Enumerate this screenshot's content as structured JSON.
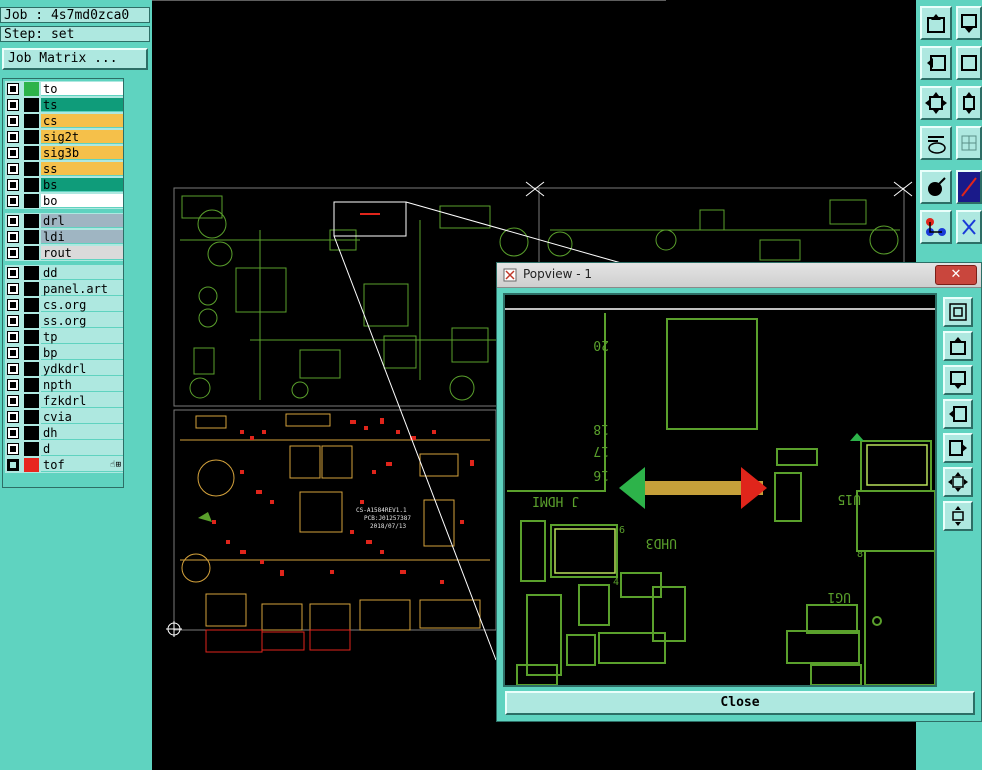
{
  "header": {
    "job_label": "Job : 4s7md0zca0",
    "step_label": "Step: set",
    "job_matrix_button": "Job Matrix ..."
  },
  "layers": {
    "group1": [
      {
        "name": "to",
        "swatch": "#2db34a",
        "bg": "#ffffff"
      },
      {
        "name": "ts",
        "swatch": "#000000",
        "bg": "#0f9c7a"
      },
      {
        "name": "cs",
        "swatch": "#000000",
        "bg": "#f5c04a"
      },
      {
        "name": "sig2t",
        "swatch": "#000000",
        "bg": "#f5c04a"
      },
      {
        "name": "sig3b",
        "swatch": "#000000",
        "bg": "#f5c04a"
      },
      {
        "name": "ss",
        "swatch": "#000000",
        "bg": "#f5c04a"
      },
      {
        "name": "bs",
        "swatch": "#000000",
        "bg": "#0f9c7a"
      },
      {
        "name": "bo",
        "swatch": "#000000",
        "bg": "#ffffff"
      }
    ],
    "group2": [
      {
        "name": "drl",
        "swatch": "#000000",
        "bg": "#9fb5c2"
      },
      {
        "name": "ldi",
        "swatch": "#000000",
        "bg": "#9fb5c2"
      },
      {
        "name": "rout",
        "swatch": "#000000",
        "bg": "#dadada"
      }
    ],
    "group3": [
      {
        "name": "dd",
        "swatch": "#000000",
        "bg": "#aee8e0"
      },
      {
        "name": "panel.art",
        "swatch": "#000000",
        "bg": "#aee8e0"
      },
      {
        "name": "cs.org",
        "swatch": "#000000",
        "bg": "#aee8e0"
      },
      {
        "name": "ss.org",
        "swatch": "#000000",
        "bg": "#aee8e0"
      },
      {
        "name": "tp",
        "swatch": "#000000",
        "bg": "#aee8e0"
      },
      {
        "name": "bp",
        "swatch": "#000000",
        "bg": "#aee8e0"
      },
      {
        "name": "ydkdrl",
        "swatch": "#000000",
        "bg": "#aee8e0"
      },
      {
        "name": "npth",
        "swatch": "#000000",
        "bg": "#aee8e0"
      },
      {
        "name": "fzkdrl",
        "swatch": "#000000",
        "bg": "#aee8e0"
      },
      {
        "name": "cvia",
        "swatch": "#000000",
        "bg": "#aee8e0"
      },
      {
        "name": "dh",
        "swatch": "#000000",
        "bg": "#aee8e0"
      },
      {
        "name": "d",
        "swatch": "#000000",
        "bg": "#aee8e0"
      },
      {
        "name": "tof",
        "swatch": "#e8261f",
        "bg": "#aee8e0",
        "active": true
      }
    ]
  },
  "board_texts": {
    "silk1": "CS-A1584REV1.1",
    "silk2": "PCB:J01257387",
    "silk3": "2018/07/13"
  },
  "popview": {
    "title": "Popview - 1",
    "close_x": "✕",
    "close_label": "Close",
    "labels": {
      "n20": "20",
      "n18": "18",
      "n17": "17",
      "n16": "16",
      "hdmi": "J HDMI",
      "uhd3": "UHD3",
      "u15": "U15",
      "ug1": "UG1",
      "n6": "6",
      "n4": "4",
      "n8": "8"
    }
  },
  "colors": {
    "panel_bg": "#5fd3c0",
    "button_bg": "#aee8e0",
    "pcb_green": "#5aa02c",
    "copper_orange": "#d4a23c",
    "copper_red": "#e0251b"
  }
}
